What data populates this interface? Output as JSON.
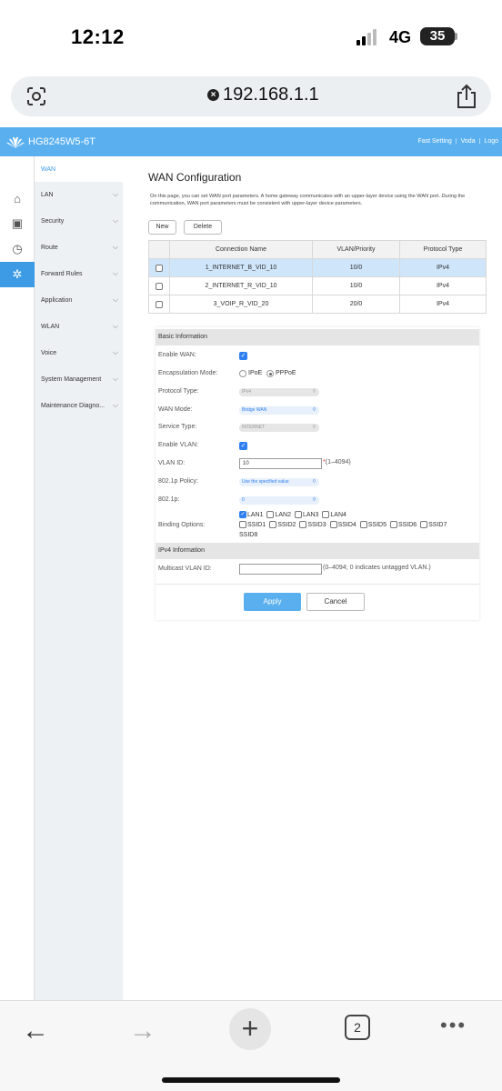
{
  "status_bar": {
    "time": "12:12",
    "network": "4G",
    "battery": "35"
  },
  "browser": {
    "url": "192.168.1.1",
    "tab_count": "2"
  },
  "router": {
    "model": "HG8245W5-6T",
    "top_links": [
      "Fast Setting",
      "Voda",
      "Logo"
    ]
  },
  "menu": {
    "items": [
      {
        "label": "WAN"
      },
      {
        "label": "LAN"
      },
      {
        "label": "Security"
      },
      {
        "label": "Route"
      },
      {
        "label": "Forward Rules"
      },
      {
        "label": "Application"
      },
      {
        "label": "WLAN"
      },
      {
        "label": "Voice"
      },
      {
        "label": "System Management"
      },
      {
        "label": "Maintenance Diagno..."
      }
    ]
  },
  "page": {
    "title": "WAN Configuration",
    "description": "On this page, you can set WAN port parameters. A home gateway communicates with an upper-layer device using the WAN port. During the communication, WAN port parameters must be consistent with upper-layer device parameters.",
    "new_label": "New",
    "delete_label": "Delete"
  },
  "table": {
    "headers": [
      "Connection Name",
      "VLAN/Priority",
      "Protocol Type"
    ],
    "rows": [
      {
        "name": "1_INTERNET_B_VID_10",
        "vlan": "10/0",
        "protocol": "IPv4"
      },
      {
        "name": "2_INTERNET_R_VID_10",
        "vlan": "10/0",
        "protocol": "IPv4"
      },
      {
        "name": "3_VOIP_R_VID_20",
        "vlan": "20/0",
        "protocol": "IPv4"
      }
    ]
  },
  "basic": {
    "heading": "Basic Information",
    "enable_wan_label": "Enable WAN:",
    "encap_label": "Encapsulation Mode:",
    "encap_ipoe": "IPoE",
    "encap_pppoe": "PPPoE",
    "protocol_label": "Protocol Type:",
    "protocol_value": "IPv4",
    "wan_mode_label": "WAN Mode:",
    "wan_mode_value": "Bridge WAN",
    "service_label": "Service Type:",
    "service_value": "INTERNET",
    "enable_vlan_label": "Enable VLAN:",
    "vlan_id_label": "VLAN ID:",
    "vlan_id_value": "10",
    "vlan_id_hint": "(1–4094)",
    "policy_label": "802.1p Policy:",
    "policy_value": "Use the specified value",
    "p8021_label": "802.1p:",
    "p8021_value": "0",
    "binding_label": "Binding Options:",
    "bindings": [
      "LAN1",
      "LAN2",
      "LAN3",
      "LAN4",
      "SSID1",
      "SSID2",
      "SSID3",
      "SSID4",
      "SSID5",
      "SSID6",
      "SSID7",
      "SSID8"
    ],
    "ipv4_heading": "IPv4 Information",
    "multicast_label": "Multicast VLAN ID:",
    "multicast_hint": "(0–4094; 0 indicates untagged VLAN.)",
    "apply_label": "Apply",
    "cancel_label": "Cancel"
  }
}
